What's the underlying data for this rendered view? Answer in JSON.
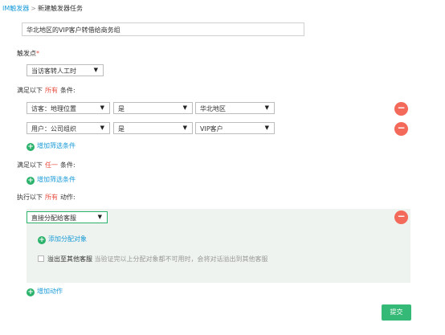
{
  "breadcrumb": {
    "parent": "IM触发器",
    "separator": ">",
    "current": "新建触发器任务"
  },
  "task_name": {
    "value": "华北地区的VIP客户转借给商务组"
  },
  "trigger": {
    "label": "触发点",
    "required_mark": "*",
    "selected": "当访客转人工时"
  },
  "all_conditions": {
    "prefix": "满足以下",
    "keyword": "所有",
    "suffix": "条件:",
    "rows": [
      {
        "field": "访客：地理位置",
        "operator": "是",
        "value": "华北地区"
      },
      {
        "field": "用户：公司组织",
        "operator": "是",
        "value": "VIP客户"
      }
    ],
    "add_label": "增加筛选条件"
  },
  "any_conditions": {
    "prefix": "满足以下",
    "keyword": "任一",
    "suffix": "条件:",
    "add_label": "增加筛选条件"
  },
  "actions": {
    "prefix": "执行以下",
    "keyword": "所有",
    "suffix": "动作:",
    "selected_action": "直接分配给客服",
    "add_target_label": "添加分配对象",
    "overflow_label": "溢出至其他客服",
    "overflow_hint": "当验证完以上分配对象都不可用时，会将对话溢出到其他客服",
    "add_action_label": "增加动作"
  },
  "submit_label": "提交",
  "icons": {
    "remove": "minus-circle-icon",
    "add": "plus-circle-icon",
    "dropdown": "caret-down-icon"
  },
  "colors": {
    "link": "#1a9bd7",
    "required": "#e84e40",
    "remove": "#f36a5a",
    "add": "#2bb26b",
    "submit": "#35b976",
    "panel": "#eef3ef"
  }
}
